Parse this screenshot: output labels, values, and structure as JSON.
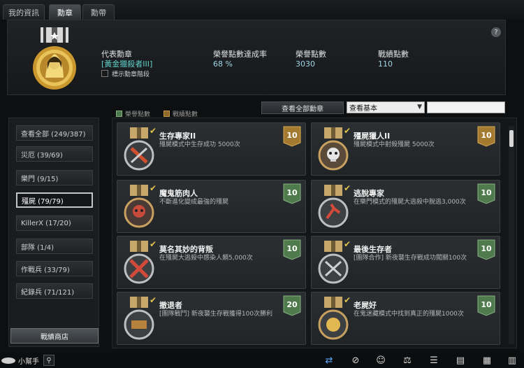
{
  "tabs": [
    {
      "label": "我的資訊"
    },
    {
      "label": "勳章"
    },
    {
      "label": "勳帶"
    }
  ],
  "header": {
    "help": "?",
    "rep_label": "代表勳章",
    "rep_name": "[黃金獵殺者III]",
    "rep_show_label": "標示勳章階段",
    "stats": [
      {
        "label": "榮譽點數達成率",
        "value": "68 %"
      },
      {
        "label": "榮譽點數",
        "value": "3030"
      },
      {
        "label": "戰績點數",
        "value": "110"
      }
    ]
  },
  "legend": {
    "honor": "榮譽點數",
    "battle": "戰績點數"
  },
  "toolbar": {
    "view_all": "查看全部勳章",
    "select_value": "查看基本",
    "search_value": ""
  },
  "sidebar": {
    "items": [
      {
        "label": "查看全部 (249/387)"
      },
      {
        "label": "災厄 (39/69)"
      },
      {
        "label": "樂門 (9/15)"
      },
      {
        "label": "殭屍 (79/79)"
      },
      {
        "label": "KillerX (17/20)"
      },
      {
        "label": "部隊 (1/4)"
      },
      {
        "label": "作戰兵 (33/79)"
      },
      {
        "label": "紀錄兵 (71/121)"
      }
    ],
    "shop_label": "戰績商店"
  },
  "cards": [
    {
      "title": "生存專家II",
      "desc": "殭屍模式中生存成功 5000次",
      "points": "10",
      "badge": "gold",
      "icon": "crossed-weapons-icon"
    },
    {
      "title": "殭屍獵人II",
      "desc": "殭屍模式中射殺殭屍 5000次",
      "points": "10",
      "badge": "gold",
      "icon": "skull-icon"
    },
    {
      "title": "魔鬼筋肉人",
      "desc": "不斷進化變成最強的殭屍",
      "points": "10",
      "badge": "green",
      "icon": "skull-icon"
    },
    {
      "title": "逃脫專家",
      "desc": "在樂門模式的殭屍大逃殺中脫逃3,000次",
      "points": "10",
      "badge": "green",
      "icon": "running-man-icon"
    },
    {
      "title": "莫名其妙的背叛",
      "desc": "在殭屍大逃殺中感染人類5,000次",
      "points": "10",
      "badge": "green",
      "icon": "crossed-figure-icon"
    },
    {
      "title": "最後生存者",
      "desc": "[團隊合作] 新夜襲生存戰成功闖關100次",
      "points": "10",
      "badge": "green",
      "icon": "crossed-rifles-icon"
    },
    {
      "title": "撤退者",
      "desc": "[團隊戰鬥] 新夜襲生存戰獲得100次勝利",
      "points": "20",
      "badge": "green",
      "icon": "ammo-icon"
    },
    {
      "title": "老屍好",
      "desc": "在鬼迷藏模式中找到真正的殭屍1000次",
      "points": "10",
      "badge": "green",
      "icon": "coin-icon"
    }
  ],
  "bottom": {
    "help_label": "小幫手",
    "icons": [
      "sync-icon",
      "compass-icon",
      "runner-icon",
      "scale-icon",
      "list-icon",
      "clipboard-icon",
      "film-icon",
      "notepad-icon"
    ]
  },
  "colors": {
    "gold_badge": "#a47a30",
    "green_badge": "#4f7a4c",
    "accent_cyan": "#5fd0c8"
  }
}
